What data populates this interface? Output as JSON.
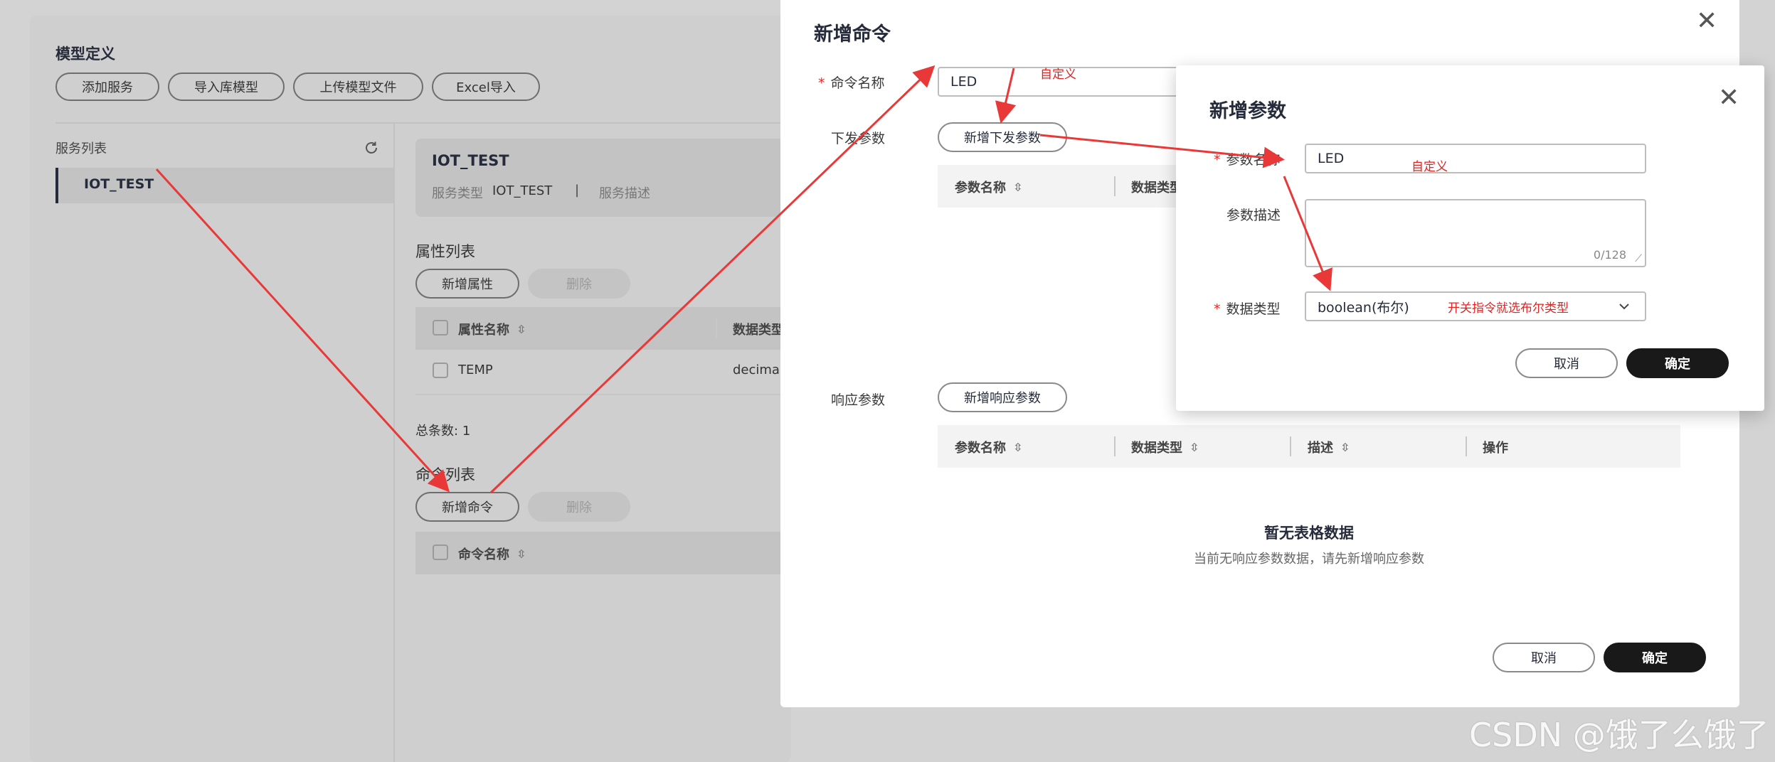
{
  "page": {
    "title": "模型定义",
    "toolbar": [
      "添加服务",
      "导入库模型",
      "上传模型文件",
      "Excel导入"
    ]
  },
  "sidebar": {
    "title": "服务列表",
    "items": [
      "IOT_TEST"
    ]
  },
  "service_card": {
    "name": "IOT_TEST",
    "type_label": "服务类型",
    "type_value": "IOT_TEST",
    "divider": "|",
    "desc_label": "服务描述"
  },
  "properties": {
    "title": "属性列表",
    "add_label": "新增属性",
    "delete_label": "删除",
    "headers": [
      "属性名称",
      "数据类型"
    ],
    "rows": [
      [
        "TEMP",
        "decimal"
      ]
    ],
    "total_label": "总条数:",
    "total": "1"
  },
  "commands": {
    "title": "命令列表",
    "add_label": "新增命令",
    "delete_label": "删除",
    "headers": [
      "命令名称"
    ]
  },
  "command_modal": {
    "title": "新增命令",
    "name_label": "命令名称",
    "name_value": "LED",
    "name_annotation": "自定义",
    "down_label": "下发参数",
    "down_add_label": "新增下发参数",
    "down_headers": [
      "参数名称",
      "数据类型"
    ],
    "resp_label": "响应参数",
    "resp_add_label": "新增响应参数",
    "resp_headers": [
      "参数名称",
      "数据类型",
      "描述",
      "操作"
    ],
    "empty_title": "暂无表格数据",
    "empty_desc": "当前无响应参数数据，请先新增响应参数",
    "cancel_label": "取消",
    "ok_label": "确定"
  },
  "param_modal": {
    "title": "新增参数",
    "name_label": "参数名称",
    "name_value": "LED",
    "name_annotation": "自定义",
    "desc_label": "参数描述",
    "desc_counter": "0/128",
    "type_label": "数据类型",
    "type_value": "boolean(布尔)",
    "type_annotation": "开关指令就选布尔类型",
    "cancel_label": "取消",
    "ok_label": "确定"
  },
  "watermark": "CSDN @饿了么饿了",
  "colors": {
    "arrow": "#e83838",
    "annotation": "#e52222",
    "primary_button": "#191919"
  }
}
